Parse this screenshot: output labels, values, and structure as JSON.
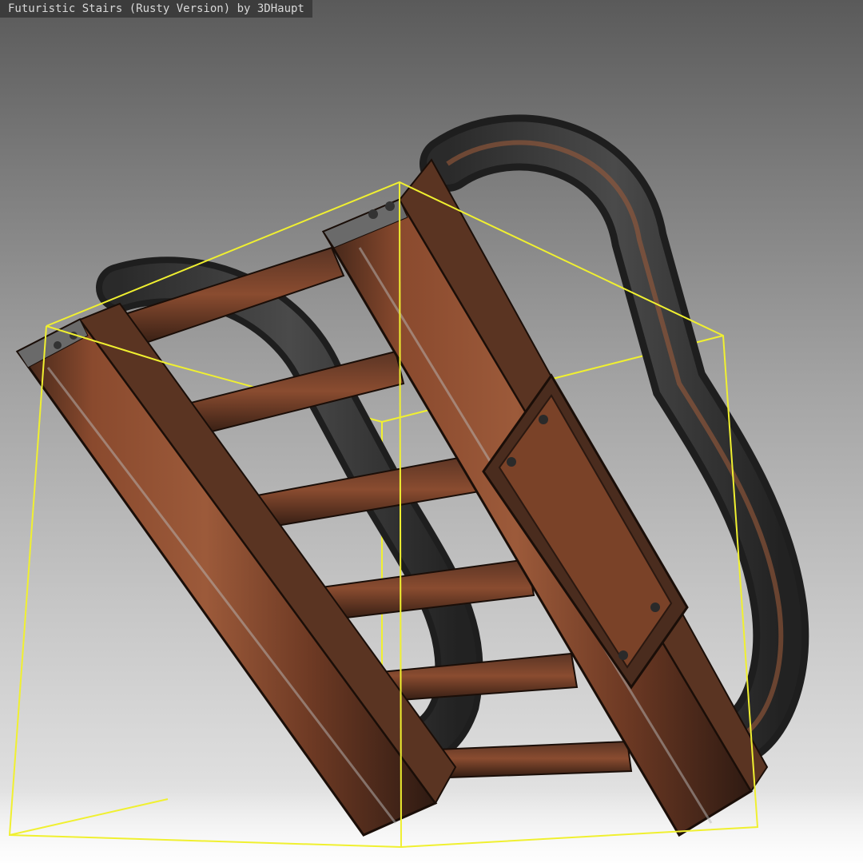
{
  "viewport": {
    "title": "Futuristic Stairs (Rusty Version) by 3DHaupt",
    "colors": {
      "rust": "#8a4a2e",
      "rust_dark": "#4a2a1e",
      "steel": "#8c8c8c",
      "bounding_box": "#f0f030",
      "background_top": "#5a5a5a",
      "background_bottom": "#f4f4f4"
    }
  }
}
